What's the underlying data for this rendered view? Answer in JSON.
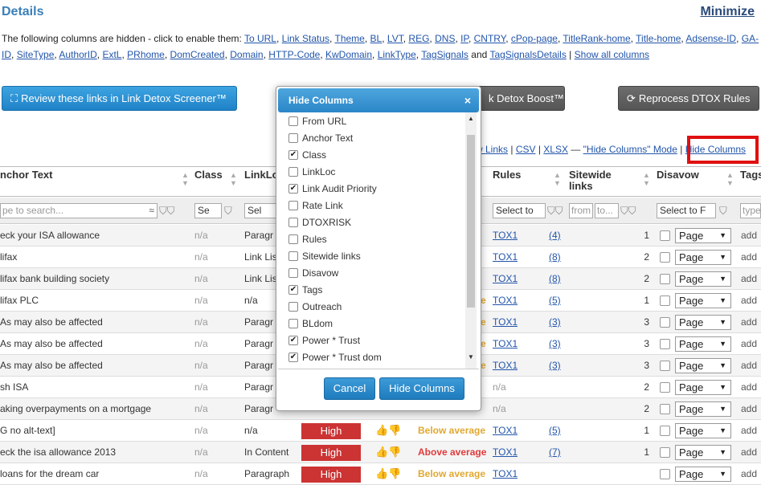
{
  "header": {
    "title": "Details",
    "minimize": "Minimize"
  },
  "hidden_note": {
    "prefix": "The following columns are hidden - click to enable them:",
    "links": [
      "To URL",
      "Link Status",
      "Theme",
      "BL",
      "LVT",
      "REG",
      "DNS",
      "IP",
      "CNTRY",
      "cPop-page",
      "TitleRank-home",
      "Title-home",
      "Adsense-ID",
      "GA-ID",
      "SiteType",
      "AuthorID",
      "ExtL",
      "PRhome",
      "DomCreated",
      "Domain",
      "HTTP-Code",
      "KwDomain",
      "LinkType",
      "TagSignals"
    ],
    "and_word": "and",
    "last_link": "TagSignalsDetails",
    "separator": "|",
    "show_all": "Show all columns"
  },
  "toolbar": {
    "review_label": "Review these links in Link Detox Screener™",
    "boost_label": "k Detox Boost™",
    "reprocess_label": "Reprocess DTOX Rules"
  },
  "exportline": {
    "links": "w Links",
    "sep1": " | ",
    "csv": "CSV",
    "sep2": " | ",
    "xlsx": "XLSX",
    "dash": " — ",
    "mode": "\"Hide Columns\" Mode",
    "sep3": " | ",
    "hide_columns": "Hide Columns"
  },
  "table": {
    "headers": {
      "anchor": "nchor Text",
      "class": "Class",
      "linkloc": "LinkLo",
      "rules": "Rules",
      "sitewide": "Sitewide links",
      "disavow": "Disavow",
      "tags": "Tags"
    },
    "filters": {
      "search_placeholder": "pe to search...",
      "class_sel": "Se",
      "linkloc_sel": "Sel",
      "rules_sel": "Select to",
      "sitewide_from": "from",
      "sitewide_to": "to...",
      "disavow_sel": "Select to F",
      "tags_placeholder": "type"
    },
    "rows": [
      {
        "anchor": "eck your ISA allowance",
        "class": "n/a",
        "linkloc": "Paragr",
        "rating": "",
        "tox": "TOX1",
        "n": "(4)",
        "sitewide": "1",
        "page": "Page",
        "tag": "add"
      },
      {
        "anchor": "lifax",
        "class": "n/a",
        "linkloc": "Link Lis",
        "rating": "",
        "tox": "TOX1",
        "n": "(8)",
        "sitewide": "2",
        "page": "Page",
        "tag": "add"
      },
      {
        "anchor": "lifax bank building society",
        "class": "n/a",
        "linkloc": "Link Lis",
        "rating": "",
        "tox": "TOX1",
        "n": "(8)",
        "sitewide": "2",
        "page": "Page",
        "tag": "add"
      },
      {
        "anchor": "lifax PLC",
        "class": "n/a",
        "linkloc": "n/a",
        "rating": "e",
        "tox": "TOX1",
        "n": "(5)",
        "sitewide": "1",
        "page": "Page",
        "tag": "add"
      },
      {
        "anchor": "As may also be affected",
        "class": "n/a",
        "linkloc": "Paragr",
        "rating": "e",
        "tox": "TOX1",
        "n": "(3)",
        "sitewide": "3",
        "page": "Page",
        "tag": "add"
      },
      {
        "anchor": "As may also be affected",
        "class": "n/a",
        "linkloc": "Paragr",
        "rating": "e",
        "tox": "TOX1",
        "n": "(3)",
        "sitewide": "3",
        "page": "Page",
        "tag": "add"
      },
      {
        "anchor": "As may also be affected",
        "class": "n/a",
        "linkloc": "Paragr",
        "rating": "e",
        "tox": "TOX1",
        "n": "(3)",
        "sitewide": "3",
        "page": "Page",
        "tag": "add"
      },
      {
        "anchor": "sh ISA",
        "class": "n/a",
        "linkloc": "Paragr",
        "rating": "",
        "tox": "n/a",
        "n": "",
        "sitewide": "2",
        "page": "Page",
        "tag": "add"
      },
      {
        "anchor": "aking overpayments on a mortgage",
        "class": "n/a",
        "linkloc": "Paragr",
        "rating": "",
        "tox": "n/a",
        "n": "",
        "sitewide": "2",
        "page": "Page",
        "tag": "add"
      },
      {
        "anchor": "G no alt-text]",
        "class": "n/a",
        "linkloc": "n/a",
        "rating": "Below average",
        "tox": "TOX1",
        "n": "(5)",
        "sitewide": "1",
        "page": "Page",
        "tag": "add",
        "risk": "High"
      },
      {
        "anchor": "eck the isa allowance 2013",
        "class": "n/a",
        "linkloc": "In Content",
        "rating": "Above average",
        "tox": "TOX1",
        "n": "(7)",
        "sitewide": "1",
        "page": "Page",
        "tag": "add",
        "risk": "High"
      },
      {
        "anchor": "loans for the dream car",
        "class": "n/a",
        "linkloc": "Paragraph",
        "rating": "Below average",
        "tox": "TOX1",
        "n": "",
        "sitewide": "",
        "page": "Page",
        "tag": "add",
        "risk": "High"
      }
    ]
  },
  "modal": {
    "title": "Hide Columns",
    "close": "×",
    "items": [
      {
        "label": "From URL",
        "checked": false
      },
      {
        "label": "Anchor Text",
        "checked": false
      },
      {
        "label": "Class",
        "checked": true
      },
      {
        "label": "LinkLoc",
        "checked": false
      },
      {
        "label": "Link Audit Priority",
        "checked": true
      },
      {
        "label": "Rate Link",
        "checked": false
      },
      {
        "label": "DTOXRISK",
        "checked": false
      },
      {
        "label": "Rules",
        "checked": false
      },
      {
        "label": "Sitewide links",
        "checked": false
      },
      {
        "label": "Disavow",
        "checked": false
      },
      {
        "label": "Tags",
        "checked": true
      },
      {
        "label": "Outreach",
        "checked": false
      },
      {
        "label": "BLdom",
        "checked": false
      },
      {
        "label": "Power * Trust",
        "checked": true
      },
      {
        "label": "Power * Trust dom",
        "checked": true
      }
    ],
    "cancel": "Cancel",
    "hide": "Hide Columns"
  },
  "colors": {
    "accent": "#2b86c8",
    "high": "#cc3333",
    "below": "#e0a830",
    "above": "#e03a3a",
    "highlight": "#e01010"
  }
}
